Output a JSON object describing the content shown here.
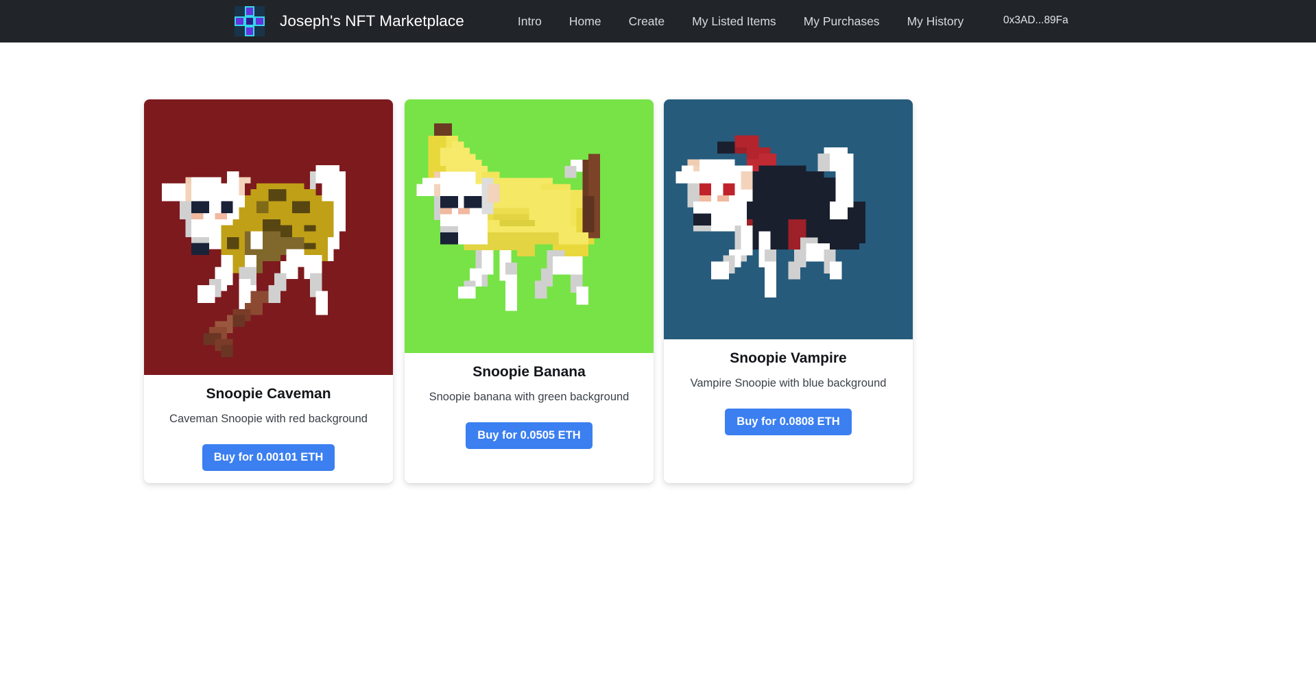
{
  "navbar": {
    "logo_icon": "pixel-cross-logo-icon",
    "logo_colors": {
      "tile": "#6434dd",
      "border": "#34d8e8",
      "center": "#2b1e8c",
      "bg": "#17344a"
    },
    "brand_title": "Joseph's NFT Marketplace",
    "background": "#212529",
    "links": [
      {
        "label": "Intro"
      },
      {
        "label": "Home"
      },
      {
        "label": "Create"
      },
      {
        "label": "My Listed Items"
      },
      {
        "label": "My Purchases"
      },
      {
        "label": "My History"
      }
    ],
    "wallet_address": "0x3AD...89Fa"
  },
  "accent": {
    "button": "#3b7ff0",
    "button_text": "#ffffff"
  },
  "cards": [
    {
      "title": "Snoopie Caveman",
      "description": "Caveman Snoopie with red background",
      "buy_label": "Buy for 0.00101 ETH",
      "price_eth": "0.00101",
      "art_background": "#7d1a1e",
      "art_name": "snoopie-caveman-pixel-art"
    },
    {
      "title": "Snoopie Banana",
      "description": "Snoopie banana with green background",
      "buy_label": "Buy for 0.0505 ETH",
      "price_eth": "0.0505",
      "art_background": "#77e347",
      "art_name": "snoopie-banana-pixel-art"
    },
    {
      "title": "Snoopie Vampire",
      "description": "Vampire Snoopie with blue background",
      "buy_label": "Buy for 0.0808 ETH",
      "price_eth": "0.0808",
      "art_background": "#265b7c",
      "art_name": "snoopie-vampire-pixel-art"
    }
  ]
}
